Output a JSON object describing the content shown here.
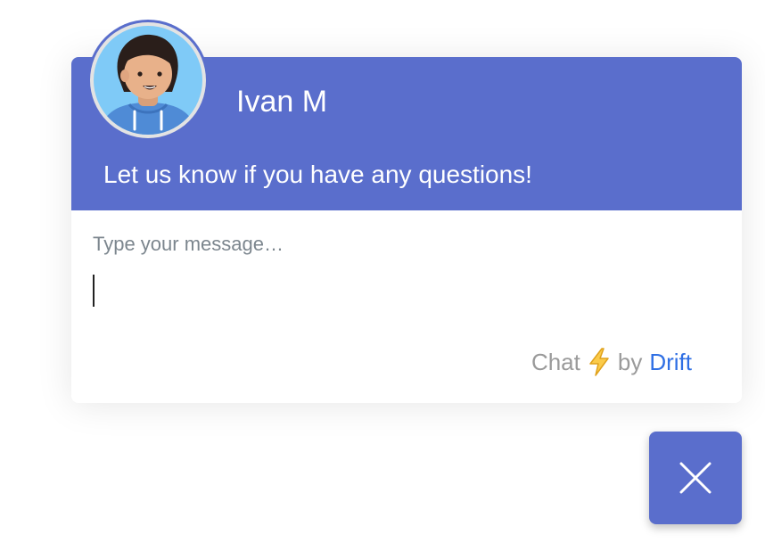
{
  "header": {
    "agent_name": "Ivan M",
    "welcome_message": "Let us know if you have any questions!",
    "avatar_icon": "person-avatar-icon"
  },
  "composer": {
    "placeholder": "Type your message…",
    "value": ""
  },
  "branding": {
    "prefix": "Chat",
    "icon": "lightning-bolt-icon",
    "by": "by",
    "brand": "Drift"
  },
  "close_button": {
    "icon": "close-x-icon"
  },
  "colors": {
    "accent": "#5a6ecc",
    "brand_link": "#2f6fe4",
    "placeholder": "#7c868e",
    "muted_text": "#9a9a9a",
    "bolt": "#f5b82e"
  }
}
